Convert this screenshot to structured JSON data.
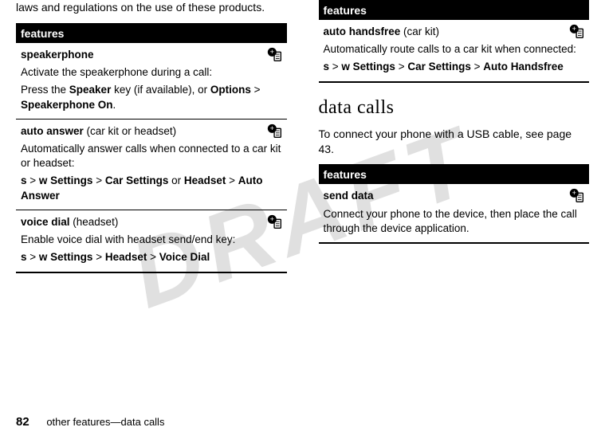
{
  "watermark": "DRAFT",
  "left": {
    "intro": "laws and regulations on the use of these products.",
    "header": "features",
    "rows": [
      {
        "title": "speakerphone",
        "sub": "",
        "desc1": "Activate the speakerphone during a call:",
        "desc2_pre": "Press the ",
        "desc2_kw1": "Speaker",
        "desc2_mid": " key (if available), or ",
        "desc2_kw2": "Options",
        "desc2_gt": " > ",
        "desc2_kw3": "Speakerphone On",
        "desc2_end": "."
      },
      {
        "title": "auto answer",
        "sub": " (car kit or headset)",
        "desc1": "Automatically answer calls when connected to a car kit or headset:",
        "path_sym": "s",
        "path_gt1": " > ",
        "path_icon": "w",
        "path_kw1": " Settings",
        "path_gt2": " > ",
        "path_kw2": "Car Settings",
        "path_or": " or ",
        "path_kw3": "Headset",
        "path_gt3": " > ",
        "path_kw4": "Auto Answer"
      },
      {
        "title": "voice dial",
        "sub": " (headset)",
        "desc1": "Enable voice dial with headset send/end key:",
        "path_sym": "s",
        "path_gt1": " > ",
        "path_icon": "w",
        "path_kw1": " Settings",
        "path_gt2": " > ",
        "path_kw2": "Headset",
        "path_gt3": " > ",
        "path_kw3": "Voice Dial"
      }
    ]
  },
  "right": {
    "header1": "features",
    "row1": {
      "title": "auto handsfree",
      "sub": " (car kit)",
      "desc1": "Automatically route calls to a car kit when connected:",
      "path_sym": "s",
      "path_gt1": " > ",
      "path_icon": "w",
      "path_kw1": " Settings",
      "path_gt2": " > ",
      "path_kw2": "Car Settings",
      "path_gt3": " > ",
      "path_kw3": "Auto Handsfree"
    },
    "section_heading": "data calls",
    "section_intro": "To connect your phone with a USB cable, see page 43.",
    "header2": "features",
    "row2": {
      "title": "send data",
      "desc1": "Connect your phone to the device, then place the call through the device application."
    }
  },
  "footer": {
    "page": "82",
    "text": "other features—data calls"
  }
}
